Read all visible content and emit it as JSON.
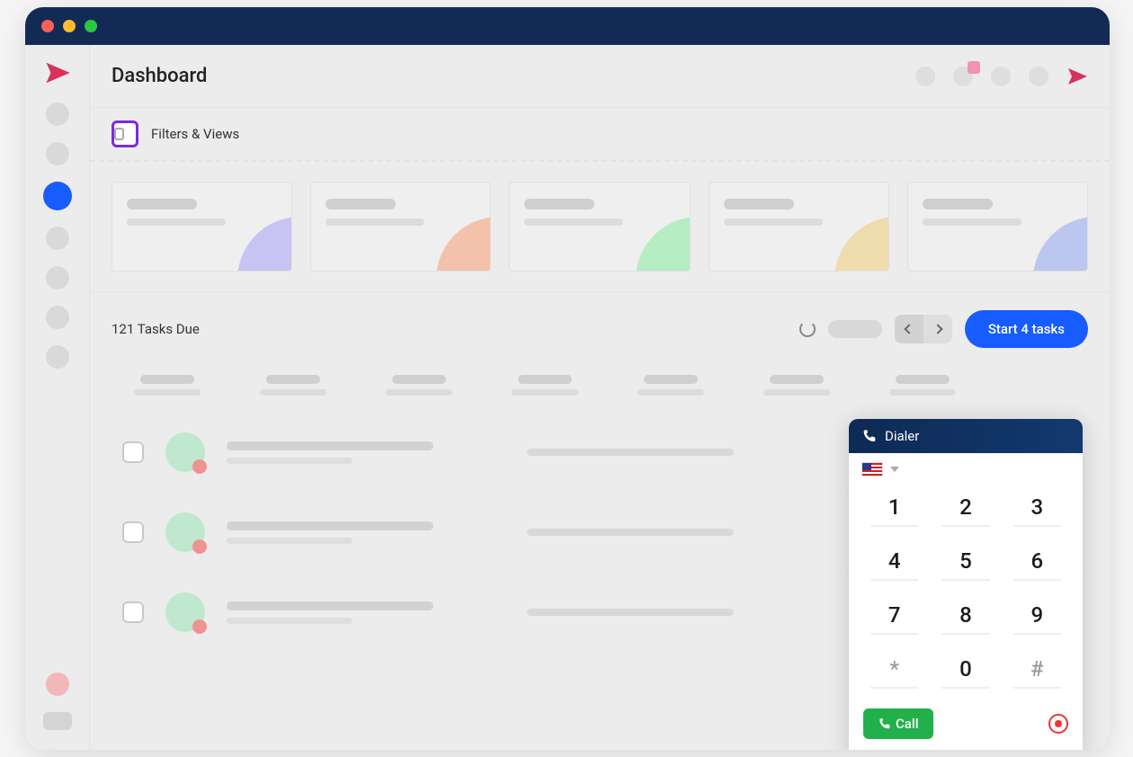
{
  "header": {
    "title": "Dashboard"
  },
  "filters": {
    "label": "Filters & Views"
  },
  "tasks": {
    "due_label": "121 Tasks Due",
    "start_label": "Start 4 tasks"
  },
  "dialer": {
    "title": "Dialer",
    "country": "US",
    "keys": [
      "1",
      "2",
      "3",
      "4",
      "5",
      "6",
      "7",
      "8",
      "9",
      "*",
      "0",
      "#"
    ],
    "call_label": "Call"
  },
  "cards": [
    {
      "tone": "purple"
    },
    {
      "tone": "orange"
    },
    {
      "tone": "green"
    },
    {
      "tone": "yellow"
    },
    {
      "tone": "blue"
    }
  ]
}
